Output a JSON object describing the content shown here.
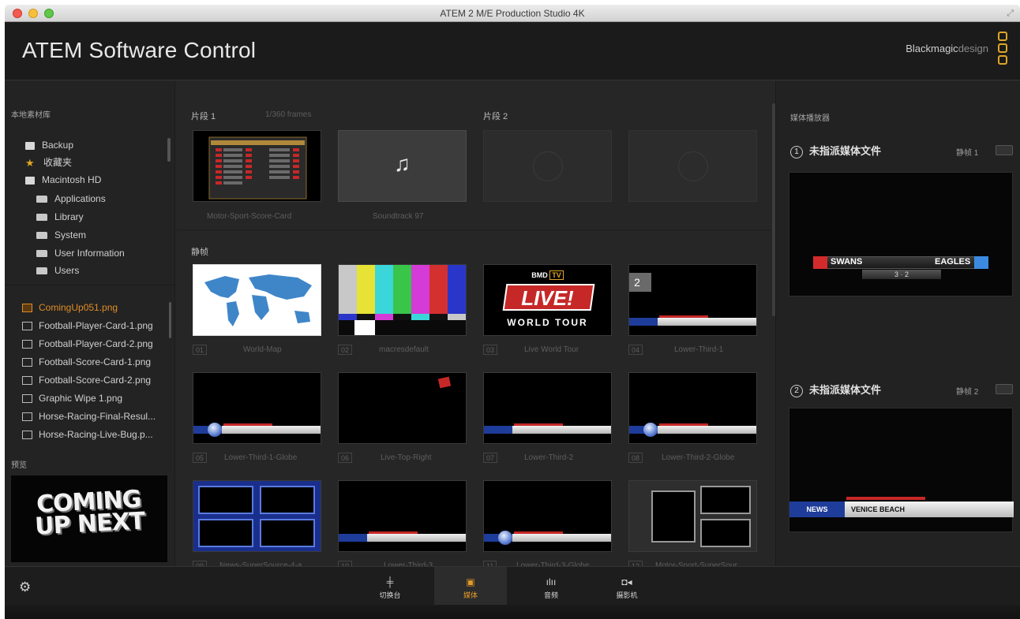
{
  "window": {
    "title": "ATEM 2 M/E Production Studio 4K"
  },
  "header": {
    "app_title": "ATEM Software Control",
    "brand_main": "Blackmagic",
    "brand_light": "design"
  },
  "left_panel": {
    "library_label": "本地素材库",
    "tree": [
      {
        "label": "Backup",
        "icon": "drive-icon"
      },
      {
        "label": "收藏夹",
        "icon": "star-icon"
      },
      {
        "label": "Macintosh HD",
        "icon": "drive-icon"
      },
      {
        "label": "Applications",
        "icon": "folder-icon"
      },
      {
        "label": "Library",
        "icon": "folder-icon"
      },
      {
        "label": "System",
        "icon": "folder-icon"
      },
      {
        "label": "User Information",
        "icon": "folder-icon"
      },
      {
        "label": "Users",
        "icon": "folder-open-icon"
      }
    ],
    "files": [
      "ComingUp051.png",
      "Football-Player-Card-1.png",
      "Football-Player-Card-2.png",
      "Football-Score-Card-1.png",
      "Football-Score-Card-2.png",
      "Graphic Wipe 1.png",
      "Horse-Racing-Final-Resul...",
      "Horse-Racing-Live-Bug.p..."
    ],
    "preview_label": "预览",
    "preview_text_line1": "COMING",
    "preview_text_line2": "UP NEXT"
  },
  "middle_panel": {
    "clip1_label": "片段 1",
    "clip1_frames": "1/360 frames",
    "clip2_label": "片段 2",
    "clips": [
      {
        "caption": "Motor-Sport-Score-Card"
      },
      {
        "caption": "Soundtrack 97"
      }
    ],
    "stills_label": "静帧",
    "stills": [
      {
        "idx": "01",
        "caption": "World-Map"
      },
      {
        "idx": "02",
        "caption": "macresdefault"
      },
      {
        "idx": "03",
        "caption": "Live World Tour"
      },
      {
        "idx": "04",
        "caption": "Lower-Third-1"
      },
      {
        "idx": "05",
        "caption": "Lower-Third-1-Globe"
      },
      {
        "idx": "06",
        "caption": "Live-Top-Right"
      },
      {
        "idx": "07",
        "caption": "Lower-Third-2"
      },
      {
        "idx": "08",
        "caption": "Lower-Third-2-Globe"
      },
      {
        "idx": "09",
        "caption": "News-SuperSource-4-a"
      },
      {
        "idx": "10",
        "caption": "Lower-Third-3"
      },
      {
        "idx": "11",
        "caption": "Lower-Third-3-Globe"
      },
      {
        "idx": "12",
        "caption": "Motor-Sport-SuperSour"
      }
    ],
    "live_bmd": "BMD",
    "live_tv": "TV",
    "live_word": "LIVE!",
    "live_sub": "WORLD TOUR",
    "badge_two": "2",
    "news": "NEWS"
  },
  "right_panel": {
    "label": "媒体播放器",
    "players": [
      {
        "num": "1",
        "title": "未指派媒体文件",
        "still": "静帧 1",
        "team_left": "SWANS",
        "team_right": "EAGLES",
        "score": "3 · 2"
      },
      {
        "num": "2",
        "title": "未指派媒体文件",
        "still": "静帧 2",
        "news": "NEWS",
        "lower_line": "VENICE BEACH"
      }
    ]
  },
  "bottom_bar": {
    "tabs": [
      {
        "label": "切换台",
        "icon": "switcher-icon"
      },
      {
        "label": "媒体",
        "icon": "media-icon"
      },
      {
        "label": "音频",
        "icon": "audio-icon"
      },
      {
        "label": "摄影机",
        "icon": "camera-icon"
      }
    ],
    "active_tab": "媒体"
  },
  "colors": {
    "accent": "#e39a27",
    "background": "#262626",
    "panel": "#1b1b1b"
  }
}
